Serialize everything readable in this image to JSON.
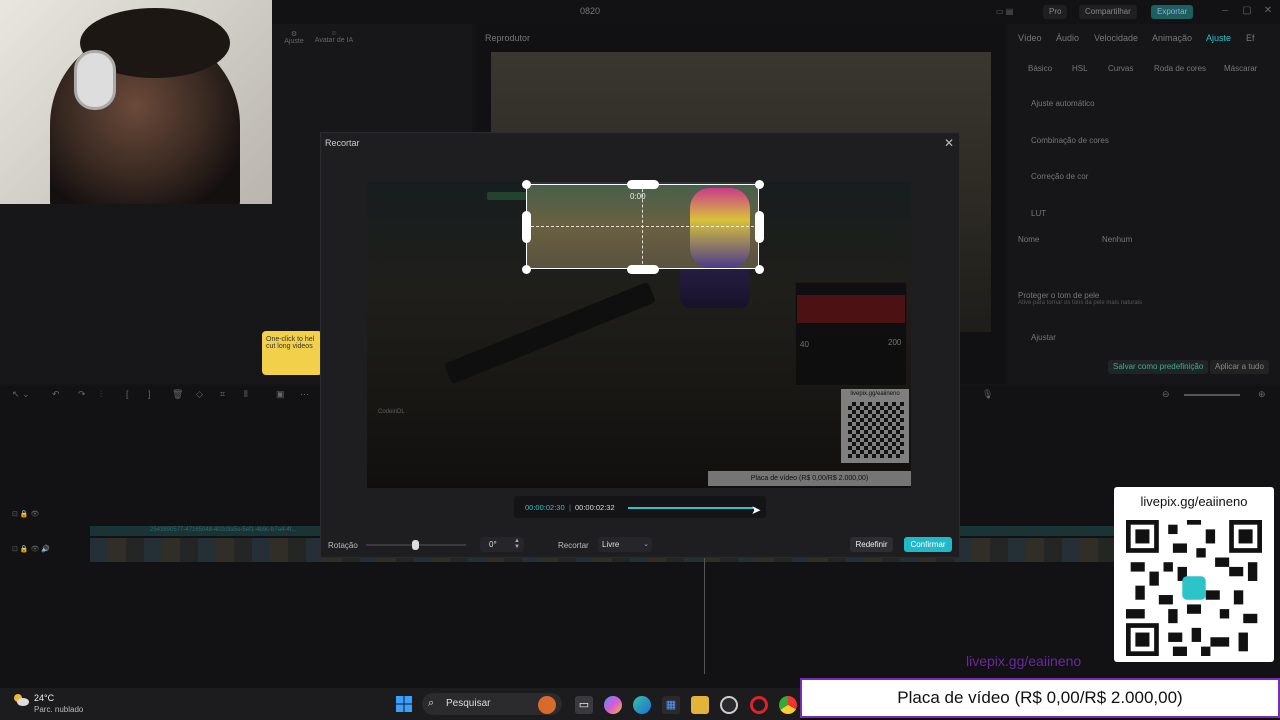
{
  "app": {
    "title": "0820",
    "header_buttons": {
      "pro": "Pro",
      "share": "Compartilhar",
      "export": "Exportar"
    },
    "left_tools": [
      "Ajuste",
      "Avatar de IA"
    ],
    "player_label": "Reprodutor",
    "right_tabs": [
      "Vídeo",
      "Áudio",
      "Velocidade",
      "Animação",
      "Ajuste",
      "Ef"
    ],
    "right_subtabs": [
      "Básico",
      "HSL",
      "Curvas",
      "Roda de cores",
      "Máscarar"
    ],
    "right_rows": [
      "Ajuste automático",
      "Combinação de cores",
      "Correção de cor",
      "LUT",
      "Proteger o tom de pele",
      "Ajustar"
    ],
    "lut_name_label": "Nome",
    "lut_name_value": "Nenhum",
    "skin_tone_hint": "Ative para tornar os tons da pele mais naturais",
    "save_preset": "Salvar como predefinição",
    "apply_all": "Aplicar a tudo",
    "clip_label": "2543890577-47165048-402c9a5e-5ef1-4b9c-b7a4-4f..."
  },
  "tooltip": {
    "text": "One-click to hel cut long videos"
  },
  "dialog": {
    "title": "Recortar",
    "close_icon": "close-icon",
    "preview": {
      "hud_timer": "0:00",
      "streamer_name": "CodeinDL",
      "canvas_qr_text": "livepix.gg/eaiineno",
      "canvas_bar_text": "Placa de vídeo (R$ 0,00/R$ 2.000,00)",
      "minimap_stats": [
        "40",
        "200"
      ]
    },
    "scrub": {
      "current": "00:00:02:30",
      "separator": "|",
      "total": "00:00:02:32",
      "progress": 0.98
    },
    "rotation": {
      "label": "Rotação",
      "value": "0°",
      "slider": 0.5
    },
    "crop": {
      "label": "Recortar",
      "selected": "Livre"
    },
    "buttons": {
      "reset": "Redefinir",
      "confirm": "Confirmar"
    }
  },
  "overlay": {
    "qr_url": "livepix.gg/eaiineno",
    "purple_url": "livepix.gg/eaiineno",
    "bar_text": "Placa de vídeo (R$ 0,00/R$ 2.000,00)"
  },
  "taskbar": {
    "temperature": "24°C",
    "condition": "Parc. nublado",
    "search_placeholder": "Pesquisar",
    "apps": [
      "windows-start-icon",
      "file-explorer-icon",
      "copilot-icon",
      "edge-icon",
      "store-icon",
      "folder-icon",
      "app-icon",
      "opera-icon",
      "chrome-icon"
    ]
  },
  "colors": {
    "accent": "#1fb9c9",
    "purple": "#7a2bb8"
  }
}
